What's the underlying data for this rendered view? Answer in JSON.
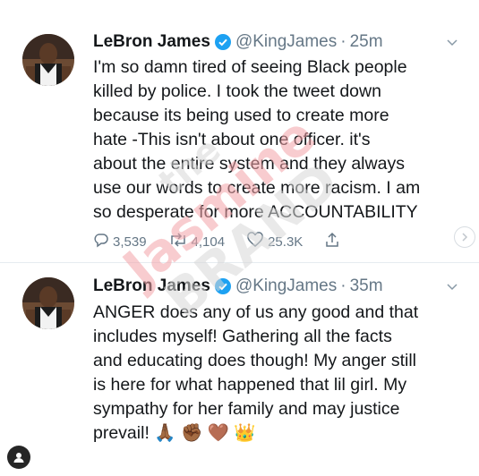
{
  "tweets": [
    {
      "name": "LeBron James",
      "handle": "@KingJames",
      "separator": "·",
      "time": "25m",
      "text": "I'm so damn tired of seeing Black people\nkilled by police. I took the tweet down\nbecause its being used to create more\nhate -This isn't about one officer.  it's\nabout the entire system and they always\nuse our words to create more racism. I am\nso desperate for more ACCOUNTABILITY",
      "replies": "3,539",
      "retweets": "4,104",
      "likes": "25.3K"
    },
    {
      "name": "LeBron James",
      "handle": "@KingJames",
      "separator": "·",
      "time": "35m",
      "text": "ANGER does any of us any good and that\nincludes myself! Gathering all the facts\nand educating does though! My anger still\nis here for what happened that lil girl. My\nsympathy for her family and may justice\nprevail! 🙏🏾 ✊🏾 🤎 👑"
    }
  ],
  "watermark": {
    "line1": "the",
    "line2": "Jasmine",
    "line3": "BRAND"
  },
  "colors": {
    "text": "#14171a",
    "muted": "#657786",
    "verified": "#1da1f2",
    "divider": "#e6ecf0"
  },
  "icons": [
    "verified-badge-icon",
    "chevron-down-icon",
    "reply-icon",
    "retweet-icon",
    "like-icon",
    "share-icon",
    "next-arrow-icon",
    "instagram-user-icon"
  ]
}
